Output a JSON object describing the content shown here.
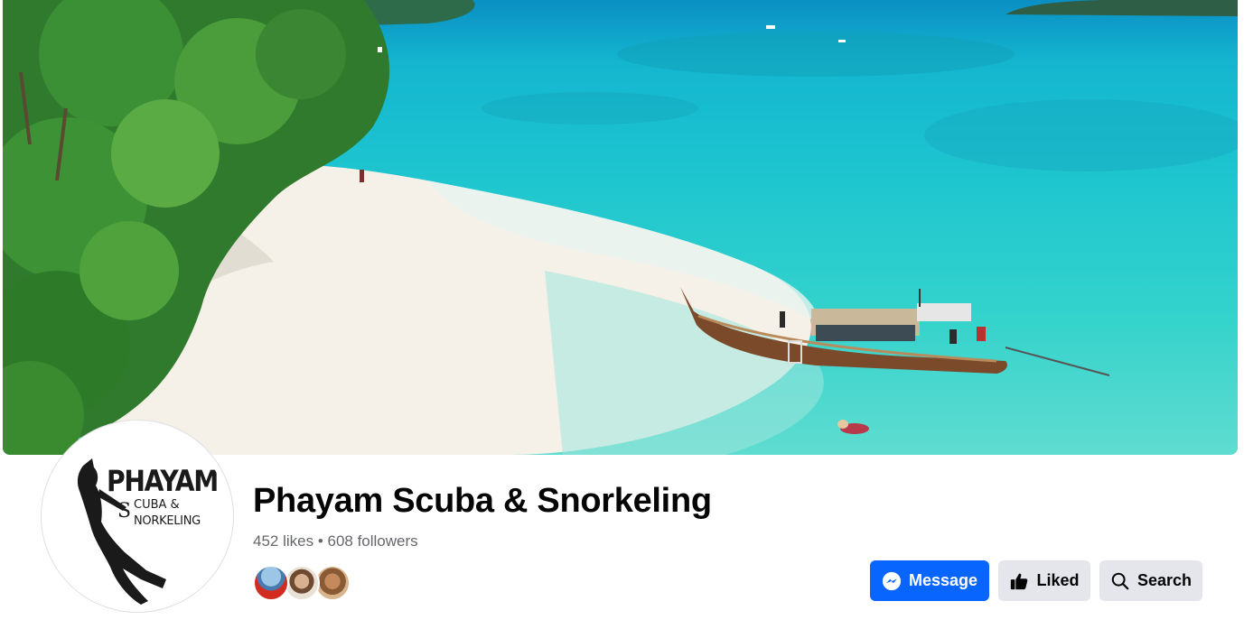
{
  "page": {
    "name": "Phayam Scuba & Snorkeling",
    "stats": "452 likes • 608 followers"
  },
  "avatar_logo": {
    "line1": "PHAYAM",
    "line2": "CUBA &",
    "line3": "NORKELING",
    "initial": "S"
  },
  "actions": {
    "message_label": "Message",
    "liked_label": "Liked",
    "search_label": "Search"
  },
  "follower_faces": [
    "face-1",
    "face-2",
    "face-3"
  ],
  "colors": {
    "primary": "#0866ff",
    "secondary_button": "#e4e6eb",
    "text_primary": "#050505",
    "text_secondary": "#65676b"
  },
  "icons": {
    "message": "messenger-icon",
    "liked": "thumbs-up-icon",
    "search": "search-icon"
  }
}
